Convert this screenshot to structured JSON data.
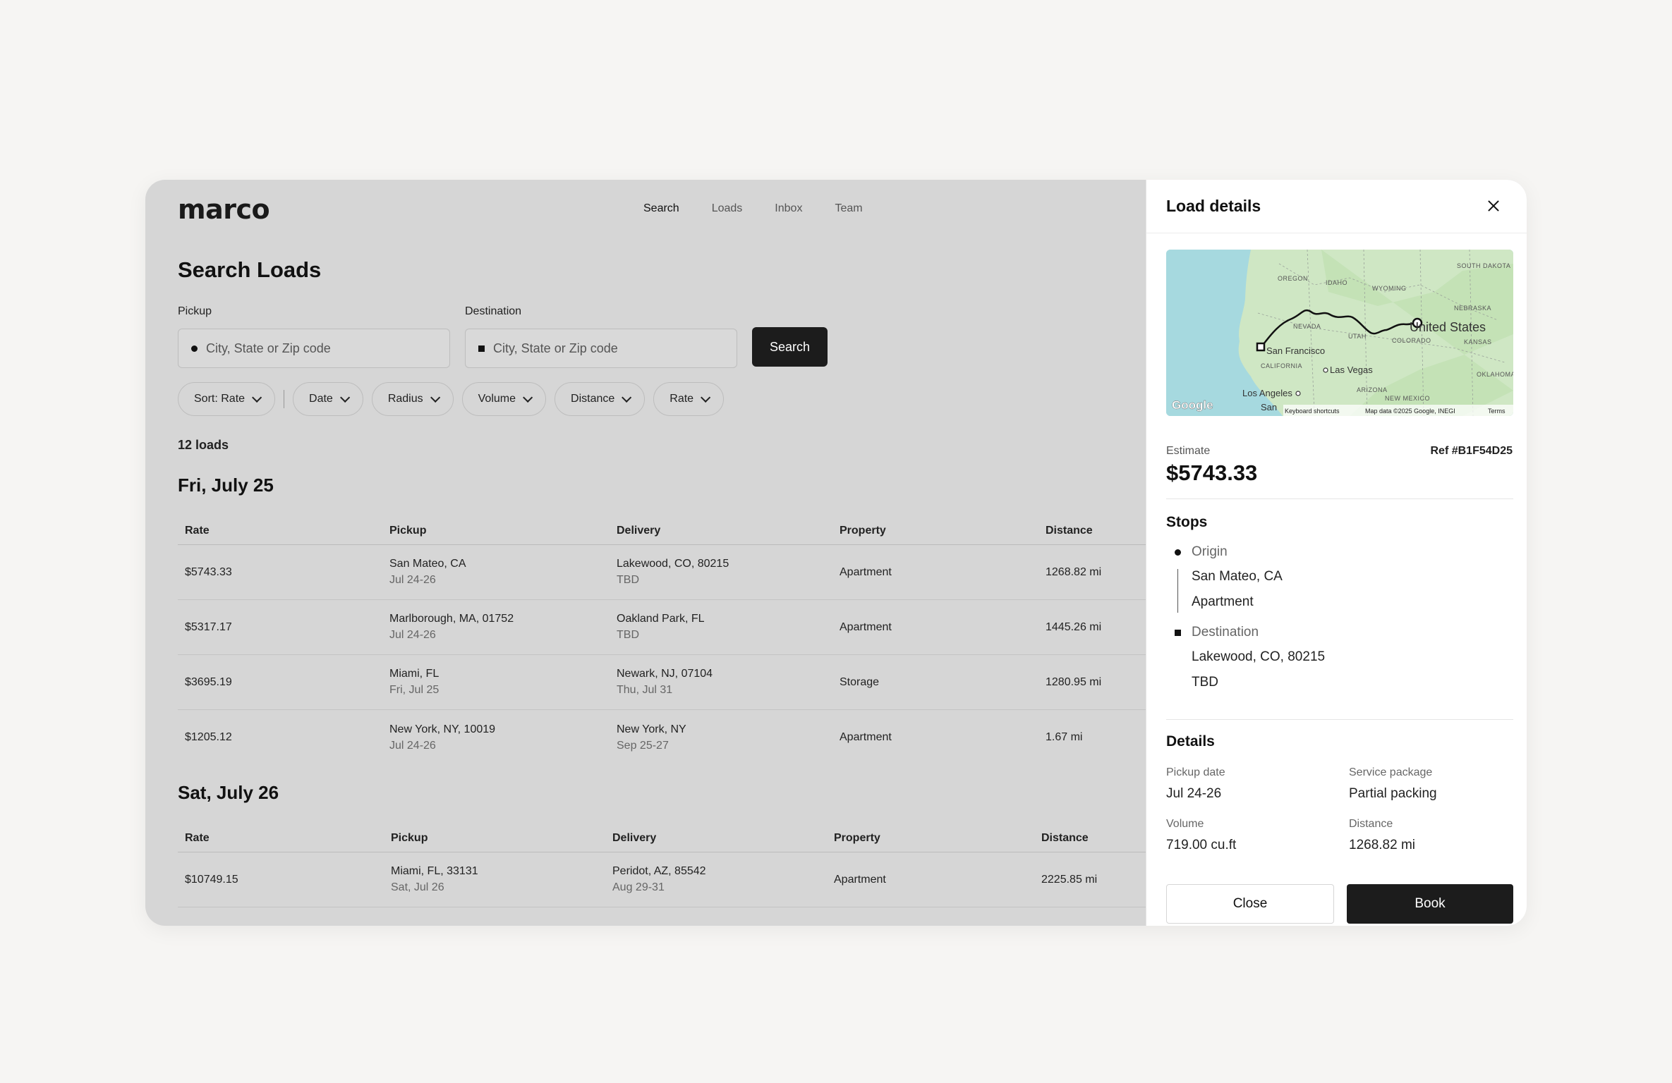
{
  "app": {
    "logo": "marco",
    "nav": [
      {
        "label": "Search",
        "state": "active"
      },
      {
        "label": "Loads",
        "state": "normal"
      },
      {
        "label": "Inbox",
        "state": "normal"
      },
      {
        "label": "Team",
        "state": "normal"
      }
    ]
  },
  "search": {
    "title": "Search Loads",
    "pickup_label": "Pickup",
    "pickup_placeholder": "City, State or Zip code",
    "destination_label": "Destination",
    "destination_placeholder": "City, State or Zip code",
    "search_button": "Search"
  },
  "filters": {
    "sort": "Sort: Rate",
    "items": [
      "Date",
      "Radius",
      "Volume",
      "Distance",
      "Rate"
    ]
  },
  "results": {
    "count": "12 loads",
    "columns": [
      "Rate",
      "Pickup",
      "Delivery",
      "Property",
      "Distance"
    ],
    "groups": [
      {
        "day": "Fri, July 25",
        "rows": [
          {
            "rate": "$5743.33",
            "pickup": "San Mateo, CA",
            "pickup_date": "Jul 24-26",
            "delivery": "Lakewood, CO, 80215",
            "delivery_date": "TBD",
            "property": "Apartment",
            "distance": "1268.82 mi"
          },
          {
            "rate": "$5317.17",
            "pickup": "Marlborough, MA, 01752",
            "pickup_date": "Jul 24-26",
            "delivery": "Oakland Park, FL",
            "delivery_date": "TBD",
            "property": "Apartment",
            "distance": "1445.26 mi"
          },
          {
            "rate": "$3695.19",
            "pickup": "Miami, FL",
            "pickup_date": "Fri, Jul 25",
            "delivery": "Newark, NJ, 07104",
            "delivery_date": "Thu, Jul 31",
            "property": "Storage",
            "distance": "1280.95 mi"
          },
          {
            "rate": "$1205.12",
            "pickup": "New York, NY, 10019",
            "pickup_date": "Jul 24-26",
            "delivery": "New York, NY",
            "delivery_date": "Sep 25-27",
            "property": "Apartment",
            "distance": "1.67 mi"
          }
        ]
      },
      {
        "day": "Sat, July 26",
        "rows": [
          {
            "rate": "$10749.15",
            "pickup": "Miami, FL, 33131",
            "pickup_date": "Sat, Jul 26",
            "delivery": "Peridot, AZ, 85542",
            "delivery_date": "Aug 29-31",
            "property": "Apartment",
            "distance": "2225.85 mi"
          }
        ]
      }
    ]
  },
  "panel": {
    "title": "Load details",
    "map": {
      "labels": [
        "OREGON",
        "IDAHO",
        "WYOMING",
        "SOUTH DAKOTA",
        "NEBRASKA",
        "NEVADA",
        "UTAH",
        "COLORADO",
        "KANSAS",
        "CALIFORNIA",
        "ARIZONA",
        "NEW MEXICO",
        "OKLAHOMA"
      ],
      "country": "United States",
      "cities": [
        "San Francisco",
        "Las Vegas",
        "Los Angeles",
        "San"
      ],
      "google": "Google",
      "footer": [
        "Keyboard shortcuts",
        "Map data ©2025 Google, INEGI",
        "Terms"
      ]
    },
    "estimate_label": "Estimate",
    "estimate_value": "$5743.33",
    "ref": "Ref #B1F54D25",
    "stops_title": "Stops",
    "origin_label": "Origin",
    "origin_city": "San Mateo, CA",
    "origin_property": "Apartment",
    "destination_label": "Destination",
    "destination_city": "Lakewood, CO, 80215",
    "destination_date": "TBD",
    "details_title": "Details",
    "pickup_date_label": "Pickup date",
    "pickup_date": "Jul 24-26",
    "service_label": "Service package",
    "service": "Partial packing",
    "volume_label": "Volume",
    "volume": "719.00 cu.ft",
    "distance_label": "Distance",
    "distance": "1268.82 mi",
    "close_button": "Close",
    "book_button": "Book"
  }
}
